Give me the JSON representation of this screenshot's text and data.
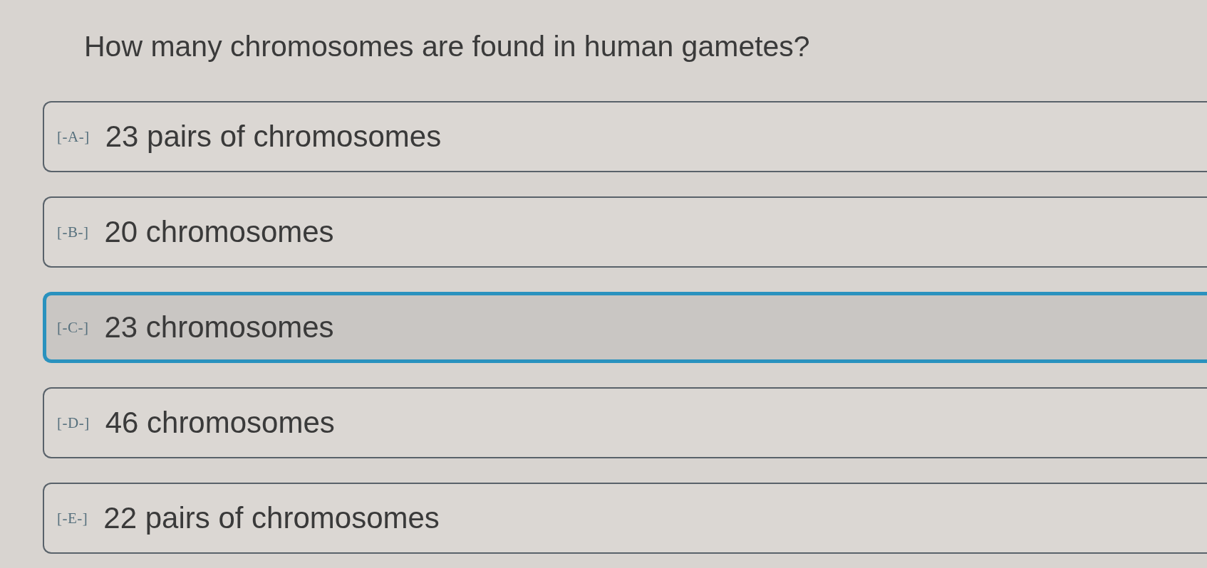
{
  "question": "How many chromosomes are found in human gametes?",
  "options": [
    {
      "letter": "[-A-]",
      "text": "23 pairs of chromosomes",
      "selected": false
    },
    {
      "letter": "[-B-]",
      "text": "20 chromosomes",
      "selected": false
    },
    {
      "letter": "[-C-]",
      "text": "23 chromosomes",
      "selected": true
    },
    {
      "letter": "[-D-]",
      "text": "46 chromosomes",
      "selected": false
    },
    {
      "letter": "[-E-]",
      "text": "22 pairs of chromosomes",
      "selected": false
    }
  ]
}
